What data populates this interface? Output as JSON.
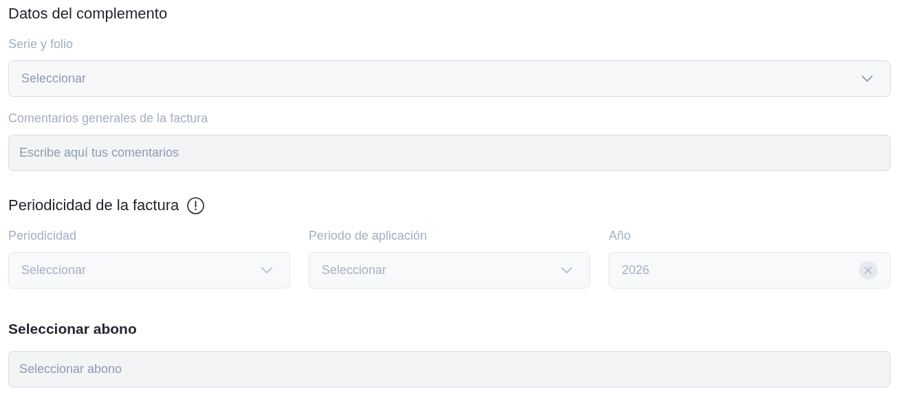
{
  "sections": [
    {
      "kind": "stack",
      "title": "Datos del complemento",
      "bold": false,
      "info_icon": false,
      "fields": [
        {
          "kind": "select",
          "label": "Serie y folio",
          "placeholder": "Seleccionar",
          "disabled": false
        },
        {
          "kind": "text",
          "label": "Comentarios generales de la factura",
          "placeholder": "Escribe aquí tus comentarios",
          "disabled": false
        }
      ]
    },
    {
      "kind": "row",
      "title": "Periodicidad de la factura",
      "bold": false,
      "info_icon": true,
      "fields": [
        {
          "kind": "select",
          "label": "Periodicidad",
          "placeholder": "Seleccionar",
          "disabled": true
        },
        {
          "kind": "select",
          "label": "Periodo de aplicación",
          "placeholder": "Seleccionar",
          "disabled": true
        },
        {
          "kind": "clearable",
          "label": "Año",
          "value": "2026",
          "disabled": true
        }
      ]
    },
    {
      "kind": "stack",
      "title": "Seleccionar abono",
      "bold": true,
      "info_icon": false,
      "fields": [
        {
          "kind": "text",
          "placeholder": "Seleccionar abono",
          "disabled": false
        }
      ]
    }
  ]
}
